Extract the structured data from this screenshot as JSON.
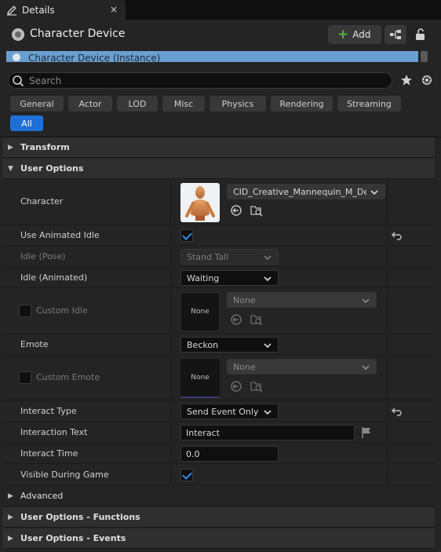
{
  "tab": {
    "title": "Details",
    "close": "×"
  },
  "header": {
    "title": "Character Device",
    "add_label": "Add"
  },
  "instance": {
    "label": "Character Device (Instance)"
  },
  "search": {
    "placeholder": "Search"
  },
  "filters": [
    "General",
    "Actor",
    "LOD",
    "Misc",
    "Physics",
    "Rendering",
    "Streaming",
    "All"
  ],
  "filter_active": "All",
  "sections": {
    "transform": "Transform",
    "user_options": "User Options",
    "advanced": "Advanced",
    "functions": "User Options - Functions",
    "events": "User Options - Events"
  },
  "props": {
    "character": {
      "label": "Character",
      "value": "CID_Creative_Mannequin_M_Default"
    },
    "use_animated_idle": {
      "label": "Use Animated Idle",
      "checked": true
    },
    "idle_pose": {
      "label": "Idle (Pose)",
      "value": "Stand Tall"
    },
    "idle_animated": {
      "label": "Idle (Animated)",
      "value": "Waiting"
    },
    "custom_idle": {
      "label": "Custom Idle",
      "thumb": "None",
      "value": "None",
      "checked": false
    },
    "emote": {
      "label": "Emote",
      "value": "Beckon"
    },
    "custom_emote": {
      "label": "Custom Emote",
      "thumb": "None",
      "value": "None",
      "checked": false
    },
    "interact_type": {
      "label": "Interact Type",
      "value": "Send Event Only"
    },
    "interaction_text": {
      "label": "Interaction Text",
      "value": "Interact"
    },
    "interact_time": {
      "label": "Interact Time",
      "value": "0.0"
    },
    "visible_during_game": {
      "label": "Visible During Game",
      "checked": true
    }
  },
  "colors": {
    "accent": "#1e70d8",
    "add_plus": "#4fb33b",
    "instance_bar": "#6a9fd1",
    "check": "#2f8de4"
  }
}
